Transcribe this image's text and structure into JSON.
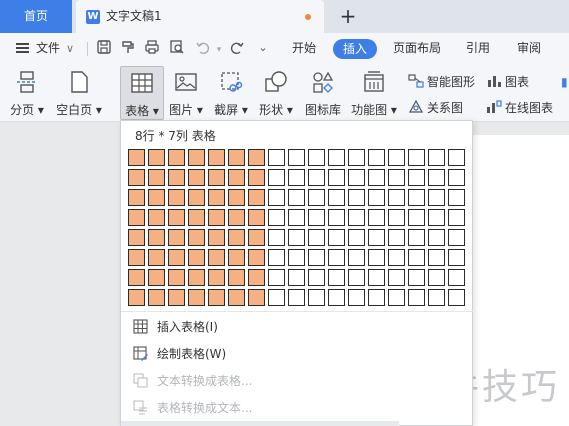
{
  "titlebar": {
    "home_tab": "首页",
    "doc_icon": "W",
    "doc_title": "文字文稿1",
    "new_tab": "+",
    "unsaved_color": "#f08a3a",
    "accent_color": "#3d7fe6"
  },
  "menubar": {
    "file_label": "文件",
    "file_arrow": "∨",
    "quick_icons": [
      "save-icon",
      "format-painter-icon",
      "print-icon",
      "print-preview-icon",
      "undo-icon",
      "redo-icon",
      "customize-icon"
    ],
    "tabs": [
      "开始",
      "插入",
      "页面布局",
      "引用",
      "审阅"
    ],
    "active_tab": "插入"
  },
  "ribbon": {
    "page_break": "分页",
    "blank_page": "空白页",
    "table": "表格",
    "picture": "图片",
    "screenshot": "截屏",
    "shape": "形状",
    "icon_lib": "图标库",
    "function_chart": "功能图",
    "smart_shape": "智能图形",
    "chart": "图表",
    "relation_chart": "关系图",
    "online_chart": "在线图表"
  },
  "table_dropdown": {
    "caption": "8行 * 7列 表格",
    "rows": 8,
    "cols": 17,
    "selected_rows": 8,
    "selected_cols": 7,
    "selected_color": "#f4b183",
    "items": [
      {
        "label": "插入表格(I)",
        "enabled": true
      },
      {
        "label": "绘制表格(W)",
        "enabled": true
      },
      {
        "label": "文本转换成表格...",
        "enabled": false
      },
      {
        "label": "表格转换成文本...",
        "enabled": false
      }
    ]
  },
  "watermark": "软件技巧"
}
